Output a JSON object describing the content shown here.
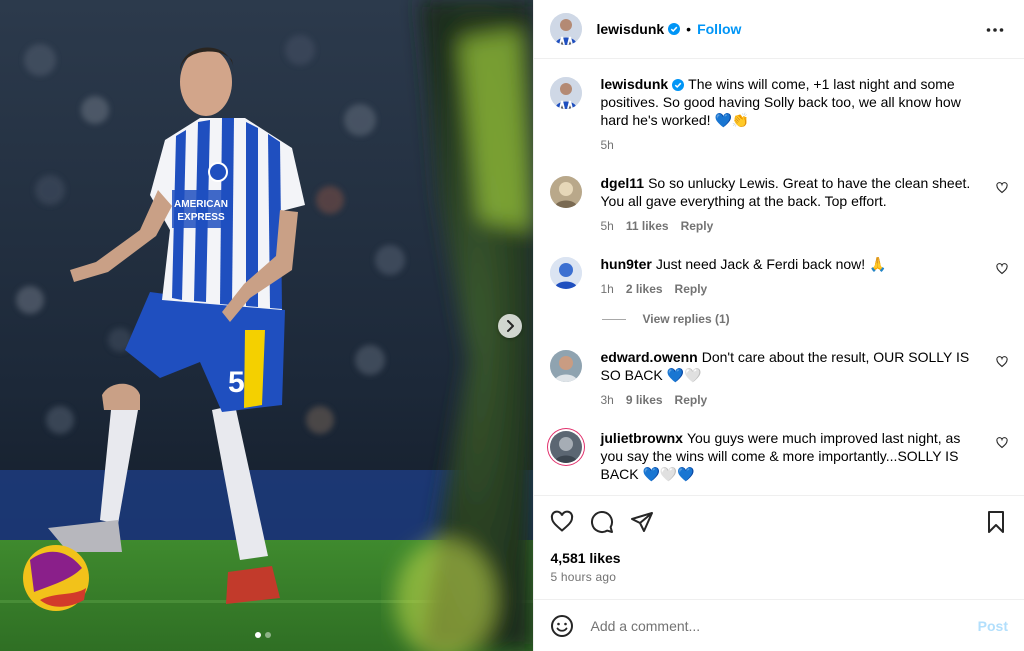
{
  "header": {
    "username": "lewisdunk",
    "separator": "•",
    "follow_label": "Follow",
    "more_icon": "more-horizontal-icon"
  },
  "caption": {
    "username": "lewisdunk",
    "text": "The wins will come, +1 last night and some positives. So good having Solly back too, we all know how hard he's worked! 💙👏",
    "time": "5h"
  },
  "comments": [
    {
      "username": "dgel11",
      "text": "So so unlucky Lewis. Great to have the clean sheet. You all gave everything at the back. Top effort.",
      "time": "5h",
      "likes": "11 likes",
      "reply": "Reply"
    },
    {
      "username": "hun9ter",
      "text": "Just need Jack & Ferdi back now! 🙏",
      "time": "1h",
      "likes": "2 likes",
      "reply": "Reply",
      "view_replies": "View replies (1)"
    },
    {
      "username": "edward.owenn",
      "text": "Don't care about the result, OUR SOLLY IS SO BACK 💙🤍",
      "time": "3h",
      "likes": "9 likes",
      "reply": "Reply"
    },
    {
      "username": "julietbrownx",
      "text": "You guys were much improved last night, as you say the wins will come & more importantly...SOLLY IS BACK 💙🤍💙"
    }
  ],
  "actions": {
    "likes": "4,581 likes",
    "time": "5 hours ago"
  },
  "add_comment": {
    "placeholder": "Add a comment...",
    "post_label": "Post"
  },
  "media": {
    "shirt_number": "5",
    "sponsor_line1": "AMERICAN",
    "sponsor_line2": "EXPRESS",
    "carousel_total": 2,
    "carousel_index": 1
  },
  "colors": {
    "accent": "#0095f6",
    "post_disabled": "#b2dffc",
    "secondary_text": "#737373",
    "brighton_blue": "#1f4fbf"
  }
}
